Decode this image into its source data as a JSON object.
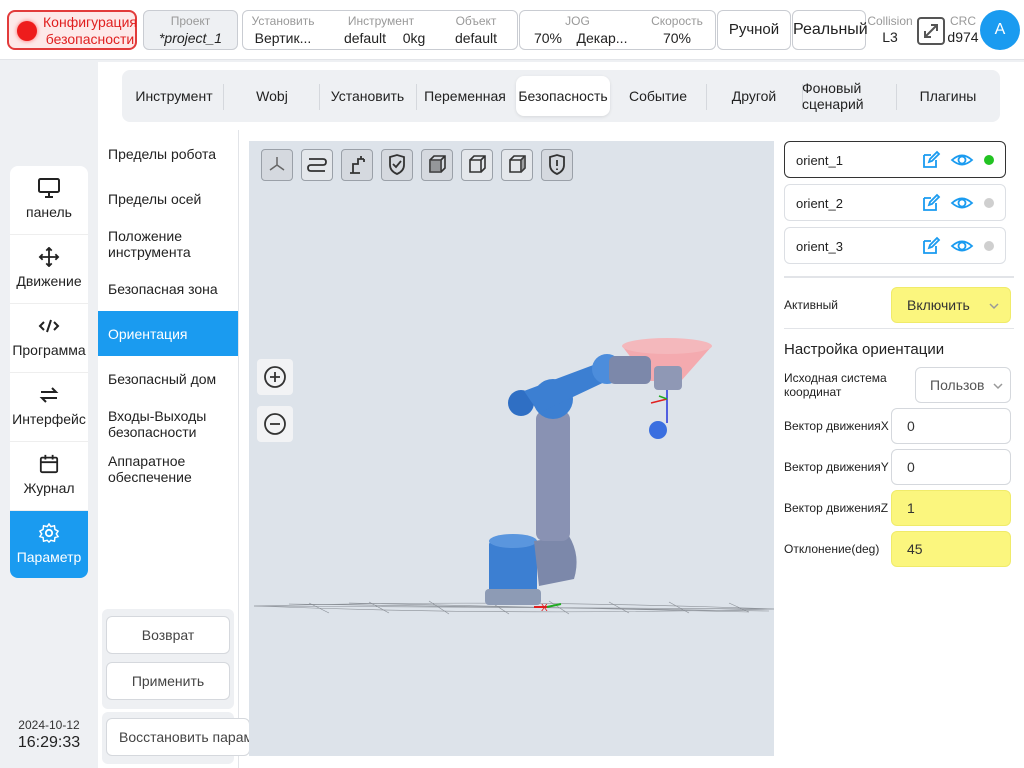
{
  "topbar": {
    "safety_config": "Конфигурация безопасности",
    "project": {
      "label": "Проект",
      "value": "*project_1"
    },
    "install": {
      "label": "Установить",
      "value": "Вертик..."
    },
    "tool": {
      "label": "Инструмент",
      "value": "default",
      "payload": "0kg"
    },
    "object": {
      "label": "Объект",
      "value": "default"
    },
    "jog": {
      "label": "JOG",
      "value": "70%",
      "frame": "Декар..."
    },
    "speed": {
      "label": "Скорость",
      "value": "70%"
    },
    "mode_manual": "Ручной",
    "mode_real": "Реальный",
    "collision": {
      "label": "Collision",
      "value": "L3"
    },
    "crc": {
      "label": "CRC",
      "value": "d974"
    },
    "avatar": "A"
  },
  "leftnav": {
    "items": [
      {
        "label": "панель",
        "icon": "monitor-icon"
      },
      {
        "label": "Движение",
        "icon": "move-icon"
      },
      {
        "label": "Программа",
        "icon": "code-icon"
      },
      {
        "label": "Интерфейс",
        "icon": "swap-icon"
      },
      {
        "label": "Журнал",
        "icon": "calendar-icon"
      },
      {
        "label": "Параметр",
        "icon": "gear-icon"
      }
    ],
    "active": "Параметр"
  },
  "clock": {
    "date": "2024-10-12",
    "time": "16:29:33"
  },
  "tabs": {
    "items": [
      "Инструмент",
      "Wobj",
      "Установить",
      "Переменная",
      "Безопасность",
      "Событие",
      "Другой",
      "Фоновый сценарий",
      "Плагины"
    ],
    "active": "Безопасность"
  },
  "submenu": {
    "items": [
      "Пределы робота",
      "Пределы осей",
      "Положение инструмента",
      "Безопасная зона",
      "Ориентация",
      "Безопасный дом",
      "Входы-Выходы безопасности",
      "Аппаратное обеспечение"
    ],
    "active": "Ориентация"
  },
  "buttons": {
    "back": "Возврат",
    "apply": "Применить",
    "restore": "Восстановить параметры"
  },
  "viewport": {
    "toolbar_icons": [
      "axes-icon",
      "path-icon",
      "robot-icon",
      "shield-check-icon",
      "cube-front-icon",
      "cube-side-icon",
      "cube-top-icon",
      "shield-alert-icon"
    ],
    "axis_label": "X"
  },
  "orientations": [
    {
      "name": "orient_1",
      "status_color": "#22c322",
      "selected": true
    },
    {
      "name": "orient_2",
      "status_color": "#cfcfcf",
      "selected": false
    },
    {
      "name": "orient_3",
      "status_color": "#cfcfcf",
      "selected": false
    }
  ],
  "form": {
    "active_label": "Активный",
    "active_value": "Включить",
    "section_title": "Настройка ориентации",
    "ref_frame_label": "Исходная система координат",
    "ref_frame_value": "Пользов",
    "vx_label": "Вектор движенияX",
    "vx_value": "0",
    "vy_label": "Вектор движенияY",
    "vy_value": "0",
    "vz_label": "Вектор движенияZ",
    "vz_value": "1",
    "dev_label": "Отклонение(deg)",
    "dev_value": "45"
  },
  "colors": {
    "accent": "#1a9bf0",
    "highlight": "#fbf67e",
    "alarm": "#e23b3b"
  }
}
